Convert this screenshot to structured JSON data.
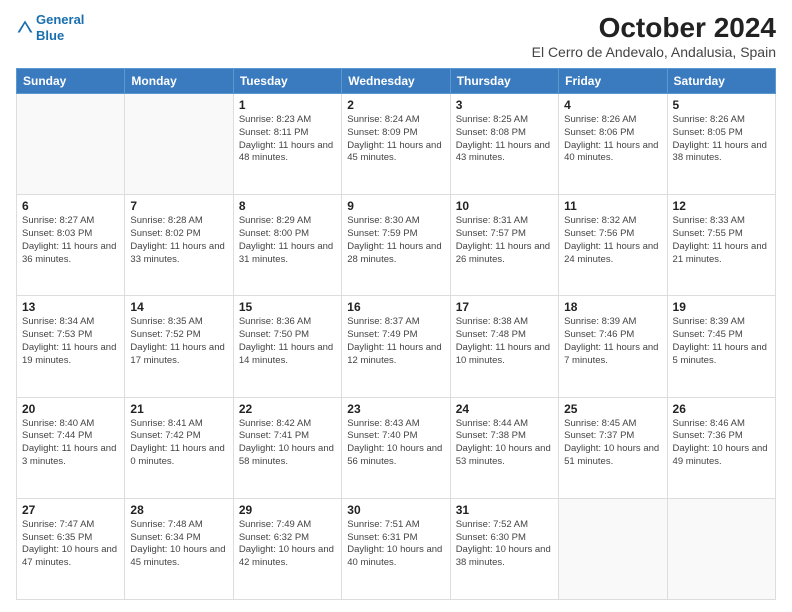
{
  "logo": {
    "line1": "General",
    "line2": "Blue"
  },
  "title": "October 2024",
  "subtitle": "El Cerro de Andevalo, Andalusia, Spain",
  "days_header": [
    "Sunday",
    "Monday",
    "Tuesday",
    "Wednesday",
    "Thursday",
    "Friday",
    "Saturday"
  ],
  "weeks": [
    [
      {
        "day": "",
        "info": ""
      },
      {
        "day": "",
        "info": ""
      },
      {
        "day": "1",
        "info": "Sunrise: 8:23 AM\nSunset: 8:11 PM\nDaylight: 11 hours and 48 minutes."
      },
      {
        "day": "2",
        "info": "Sunrise: 8:24 AM\nSunset: 8:09 PM\nDaylight: 11 hours and 45 minutes."
      },
      {
        "day": "3",
        "info": "Sunrise: 8:25 AM\nSunset: 8:08 PM\nDaylight: 11 hours and 43 minutes."
      },
      {
        "day": "4",
        "info": "Sunrise: 8:26 AM\nSunset: 8:06 PM\nDaylight: 11 hours and 40 minutes."
      },
      {
        "day": "5",
        "info": "Sunrise: 8:26 AM\nSunset: 8:05 PM\nDaylight: 11 hours and 38 minutes."
      }
    ],
    [
      {
        "day": "6",
        "info": "Sunrise: 8:27 AM\nSunset: 8:03 PM\nDaylight: 11 hours and 36 minutes."
      },
      {
        "day": "7",
        "info": "Sunrise: 8:28 AM\nSunset: 8:02 PM\nDaylight: 11 hours and 33 minutes."
      },
      {
        "day": "8",
        "info": "Sunrise: 8:29 AM\nSunset: 8:00 PM\nDaylight: 11 hours and 31 minutes."
      },
      {
        "day": "9",
        "info": "Sunrise: 8:30 AM\nSunset: 7:59 PM\nDaylight: 11 hours and 28 minutes."
      },
      {
        "day": "10",
        "info": "Sunrise: 8:31 AM\nSunset: 7:57 PM\nDaylight: 11 hours and 26 minutes."
      },
      {
        "day": "11",
        "info": "Sunrise: 8:32 AM\nSunset: 7:56 PM\nDaylight: 11 hours and 24 minutes."
      },
      {
        "day": "12",
        "info": "Sunrise: 8:33 AM\nSunset: 7:55 PM\nDaylight: 11 hours and 21 minutes."
      }
    ],
    [
      {
        "day": "13",
        "info": "Sunrise: 8:34 AM\nSunset: 7:53 PM\nDaylight: 11 hours and 19 minutes."
      },
      {
        "day": "14",
        "info": "Sunrise: 8:35 AM\nSunset: 7:52 PM\nDaylight: 11 hours and 17 minutes."
      },
      {
        "day": "15",
        "info": "Sunrise: 8:36 AM\nSunset: 7:50 PM\nDaylight: 11 hours and 14 minutes."
      },
      {
        "day": "16",
        "info": "Sunrise: 8:37 AM\nSunset: 7:49 PM\nDaylight: 11 hours and 12 minutes."
      },
      {
        "day": "17",
        "info": "Sunrise: 8:38 AM\nSunset: 7:48 PM\nDaylight: 11 hours and 10 minutes."
      },
      {
        "day": "18",
        "info": "Sunrise: 8:39 AM\nSunset: 7:46 PM\nDaylight: 11 hours and 7 minutes."
      },
      {
        "day": "19",
        "info": "Sunrise: 8:39 AM\nSunset: 7:45 PM\nDaylight: 11 hours and 5 minutes."
      }
    ],
    [
      {
        "day": "20",
        "info": "Sunrise: 8:40 AM\nSunset: 7:44 PM\nDaylight: 11 hours and 3 minutes."
      },
      {
        "day": "21",
        "info": "Sunrise: 8:41 AM\nSunset: 7:42 PM\nDaylight: 11 hours and 0 minutes."
      },
      {
        "day": "22",
        "info": "Sunrise: 8:42 AM\nSunset: 7:41 PM\nDaylight: 10 hours and 58 minutes."
      },
      {
        "day": "23",
        "info": "Sunrise: 8:43 AM\nSunset: 7:40 PM\nDaylight: 10 hours and 56 minutes."
      },
      {
        "day": "24",
        "info": "Sunrise: 8:44 AM\nSunset: 7:38 PM\nDaylight: 10 hours and 53 minutes."
      },
      {
        "day": "25",
        "info": "Sunrise: 8:45 AM\nSunset: 7:37 PM\nDaylight: 10 hours and 51 minutes."
      },
      {
        "day": "26",
        "info": "Sunrise: 8:46 AM\nSunset: 7:36 PM\nDaylight: 10 hours and 49 minutes."
      }
    ],
    [
      {
        "day": "27",
        "info": "Sunrise: 7:47 AM\nSunset: 6:35 PM\nDaylight: 10 hours and 47 minutes."
      },
      {
        "day": "28",
        "info": "Sunrise: 7:48 AM\nSunset: 6:34 PM\nDaylight: 10 hours and 45 minutes."
      },
      {
        "day": "29",
        "info": "Sunrise: 7:49 AM\nSunset: 6:32 PM\nDaylight: 10 hours and 42 minutes."
      },
      {
        "day": "30",
        "info": "Sunrise: 7:51 AM\nSunset: 6:31 PM\nDaylight: 10 hours and 40 minutes."
      },
      {
        "day": "31",
        "info": "Sunrise: 7:52 AM\nSunset: 6:30 PM\nDaylight: 10 hours and 38 minutes."
      },
      {
        "day": "",
        "info": ""
      },
      {
        "day": "",
        "info": ""
      }
    ]
  ]
}
